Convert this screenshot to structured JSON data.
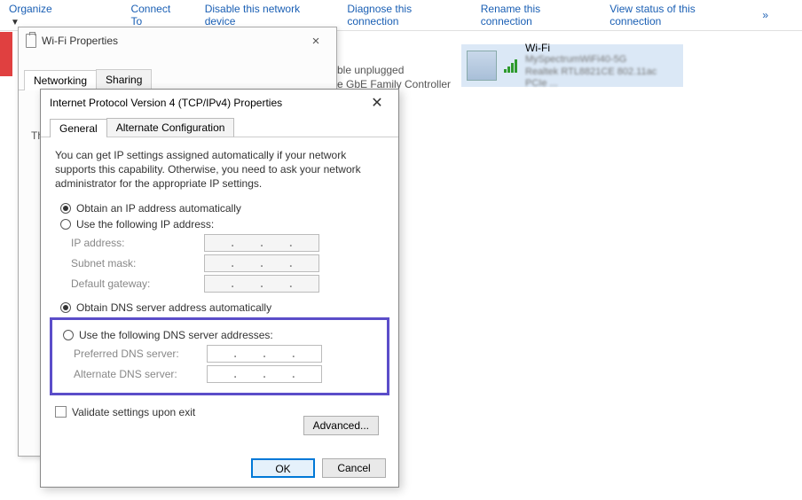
{
  "toolbar": {
    "organize": "Organize",
    "connect_to": "Connect To",
    "disable": "Disable this network device",
    "diagnose": "Diagnose this connection",
    "rename": "Rename this connection",
    "view_status": "View status of this connection",
    "more": "»"
  },
  "bg": {
    "line1": "ble unplugged",
    "line2": "e GbE Family Controller"
  },
  "wifi_card": {
    "title": "Wi-Fi",
    "sub1": "MySpectrumWiFi40-5G",
    "sub2": "Realtek RTL8821CE 802.11ac PCIe ..."
  },
  "dlg1": {
    "title": "Wi-Fi Properties",
    "tab_networking": "Networking",
    "tab_sharing": "Sharing",
    "th_label": "Th"
  },
  "dlg2": {
    "title": "Internet Protocol Version 4 (TCP/IPv4) Properties",
    "tab_general": "General",
    "tab_alt": "Alternate Configuration",
    "desc": "You can get IP settings assigned automatically if your network supports this capability. Otherwise, you need to ask your network administrator for the appropriate IP settings.",
    "ip": {
      "auto": "Obtain an IP address automatically",
      "manual": "Use the following IP address:",
      "addr": "IP address:",
      "mask": "Subnet mask:",
      "gateway": "Default gateway:"
    },
    "dns": {
      "auto": "Obtain DNS server address automatically",
      "manual": "Use the following DNS server addresses:",
      "pref": "Preferred DNS server:",
      "alt": "Alternate DNS server:"
    },
    "validate": "Validate settings upon exit",
    "advanced": "Advanced...",
    "ok": "OK",
    "cancel": "Cancel"
  }
}
